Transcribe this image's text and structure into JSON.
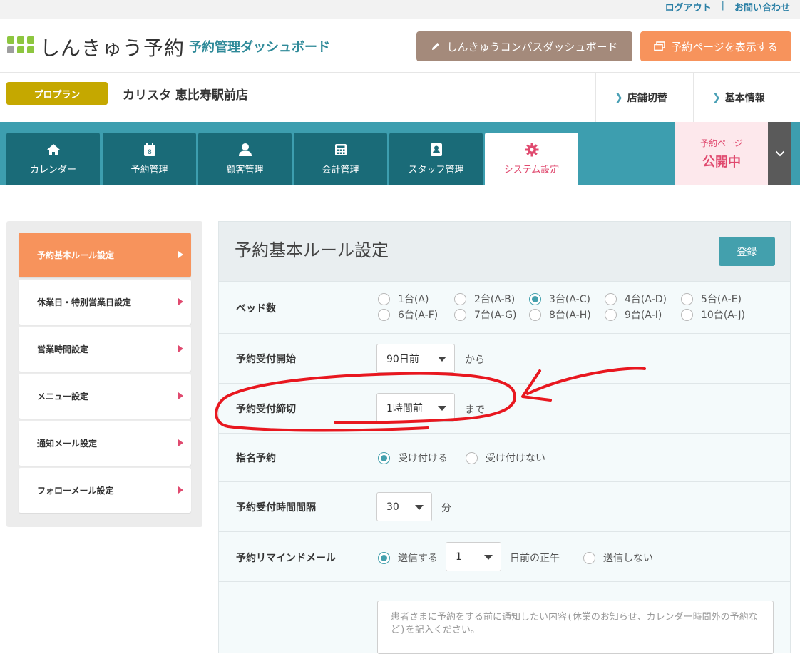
{
  "util": {
    "logout": "ログアウト",
    "separator": "|",
    "contact": "お問い合わせ"
  },
  "header": {
    "logo_text": "しんきゅう予約",
    "subtitle": "予約管理ダッシュボード",
    "compass_button": "しんきゅうコンパスダッシュボード",
    "view_button": "予約ページを表示する",
    "logo_colors": [
      "#8dc63f",
      "#8dc63f",
      "#8dc63f",
      "#9e9e9e",
      "#8dc63f",
      "#8dc63f"
    ]
  },
  "store": {
    "plan": "プロプラン",
    "name": "カリスタ 恵比寿駅前店",
    "switch_link": "店舗切替",
    "info_link": "基本情報"
  },
  "nav": {
    "tabs": [
      {
        "label": "カレンダー",
        "icon": "home-icon"
      },
      {
        "label": "予約管理",
        "icon": "calendar-icon"
      },
      {
        "label": "顧客管理",
        "icon": "person-icon"
      },
      {
        "label": "会計管理",
        "icon": "calculator-icon"
      },
      {
        "label": "スタッフ管理",
        "icon": "id-card-icon"
      },
      {
        "label": "システム設定",
        "icon": "gear-icon"
      }
    ],
    "calendar_icon_day": "8",
    "public_label": "予約ページ",
    "public_status": "公開中"
  },
  "sidebar": {
    "items": [
      {
        "label": "予約基本ルール設定",
        "active": true
      },
      {
        "label": "休業日・特別営業日設定"
      },
      {
        "label": "営業時間設定"
      },
      {
        "label": "メニュー設定"
      },
      {
        "label": "通知メール設定"
      },
      {
        "label": "フォローメール設定"
      }
    ]
  },
  "main": {
    "title": "予約基本ルール設定",
    "save_button": "登録",
    "beds": {
      "label": "ベッド数",
      "options": [
        "1台(A)",
        "2台(A-B)",
        "3台(A-C)",
        "4台(A-D)",
        "5台(A-E)",
        "6台(A-F)",
        "7台(A-G)",
        "8台(A-H)",
        "9台(A-I)",
        "10台(A-J)"
      ],
      "selected": "3台(A-C)"
    },
    "start": {
      "label": "予約受付開始",
      "value": "90日前",
      "suffix": "から"
    },
    "deadline": {
      "label": "予約受付締切",
      "value": "1時間前",
      "suffix": "まで"
    },
    "nomination": {
      "label": "指名予約",
      "option_yes": "受け付ける",
      "option_no": "受け付けない",
      "selected": "受け付ける"
    },
    "interval": {
      "label": "予約受付時間間隔",
      "value": "30",
      "suffix": "分"
    },
    "reminder": {
      "label": "予約リマインドメール",
      "option_send": "送信する",
      "days": "1",
      "days_suffix": "日前の正午",
      "option_no": "送信しない",
      "selected": "送信する"
    },
    "note_placeholder": "患者さまに予約をする前に通知したい内容(休業のお知らせ、カレンダー時間外の予約など)を記入ください。"
  },
  "colors": {
    "teal": "#3d9eaf",
    "dark_teal": "#1a6b78",
    "orange": "#f7935c",
    "brown": "#a48a7b",
    "gold": "#c5a800",
    "pink": "#e04a6f",
    "annotation_red": "#e8171f"
  }
}
